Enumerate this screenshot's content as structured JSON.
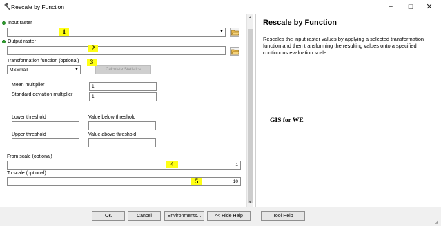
{
  "window": {
    "title": "Rescale by Function",
    "minimize_glyph": "–",
    "maximize_glyph": "☐",
    "close_glyph": "✕"
  },
  "form": {
    "input_raster": {
      "label": "Input raster",
      "value": ""
    },
    "output_raster": {
      "label": "Output raster",
      "value": ""
    },
    "transformation": {
      "label": "Transformation function (optional)",
      "selected": "MSSmall",
      "calc_stats_label": "Calculate Statistics"
    },
    "mean_multiplier": {
      "label": "Mean multiplier",
      "value": "1"
    },
    "std_multiplier": {
      "label": "Standard deviation multiplier",
      "value": "1"
    },
    "lower_threshold": {
      "label": "Lower threshold",
      "value": ""
    },
    "value_below": {
      "label": "Value below threshold",
      "value": ""
    },
    "upper_threshold": {
      "label": "Upper threshold",
      "value": ""
    },
    "value_above": {
      "label": "Value above threshold",
      "value": ""
    },
    "from_scale": {
      "label": "From scale (optional)",
      "value": "1"
    },
    "to_scale": {
      "label": "To scale (optional)",
      "value": "10"
    }
  },
  "annotations": [
    "1",
    "2",
    "3",
    "4",
    "5"
  ],
  "help": {
    "title": "Rescale by Function",
    "body": "Rescales the input raster values by applying a selected transformation function and then transforming the resulting values onto a specified continuous evaluation scale.",
    "watermark": "GIS for WE"
  },
  "buttons": {
    "ok": "OK",
    "cancel": "Cancel",
    "environments": "Environments...",
    "hide_help": "<< Hide Help",
    "tool_help": "Tool Help"
  },
  "colors": {
    "highlight": "#ffff14",
    "required_dot": "#2fa42f",
    "folder": "#e8b84a"
  },
  "icons": {
    "app": "hammer-icon",
    "browse": "folder-open-icon",
    "required": "required-dot-icon",
    "dropdown": "chevron-down-icon"
  }
}
